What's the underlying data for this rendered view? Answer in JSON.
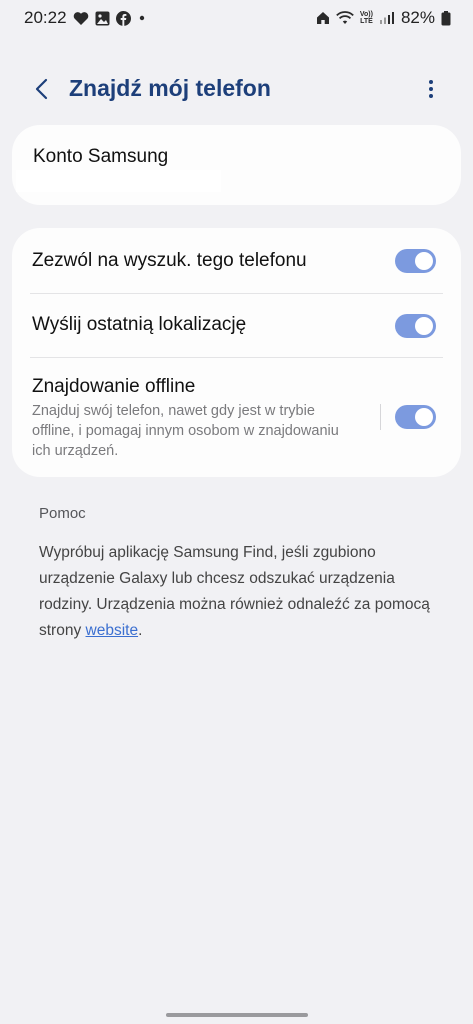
{
  "status_bar": {
    "time": "20:22",
    "left_icons": [
      "heart-icon",
      "image-icon",
      "facebook-icon",
      "dot-icon"
    ],
    "right_icons": [
      "home-icon",
      "wifi-icon",
      "volte-icon",
      "signal-icon"
    ],
    "battery_text": "82%",
    "volte_label_top": "Vo))",
    "volte_label_bottom": "LTE"
  },
  "header": {
    "title": "Znajdź mój telefon",
    "back_icon": "chevron-left-icon",
    "more_icon": "more-vert-icon"
  },
  "account": {
    "label": "Konto Samsung"
  },
  "settings": {
    "rows": [
      {
        "label": "Zezwól na wyszuk. tego telefonu",
        "enabled": true
      },
      {
        "label": "Wyślij ostatnią lokalizację",
        "enabled": true
      },
      {
        "label": "Znajdowanie offline",
        "description": "Znajduj swój telefon, nawet gdy jest w trybie offline, i pomagaj innym osobom w znajdowaniu ich urządzeń.",
        "enabled": true
      }
    ]
  },
  "help": {
    "heading": "Pomoc",
    "text_before_link": "Wypróbuj aplikację Samsung Find, jeśli zgubiono urządzenie Galaxy lub chcesz odszukać urządzenia rodziny. Urządzenia można również odnaleźć za pomocą strony ",
    "link_text": "website",
    "text_after_link": "."
  },
  "colors": {
    "background": "#f1f1f4",
    "card": "#fdfdfd",
    "title": "#1d3f7a",
    "toggle_on": "#7c9adf",
    "link": "#3b6fd0"
  }
}
